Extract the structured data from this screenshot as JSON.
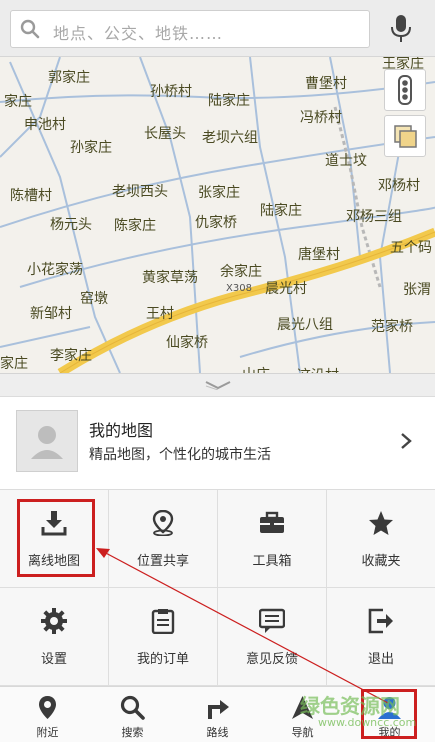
{
  "search": {
    "placeholder": "地点、公交、地铁……"
  },
  "map": {
    "places": [
      "王家庄",
      "郭家庄",
      "孙桥村",
      "曹堡村",
      "家庄",
      "陆家庄",
      "申池村",
      "冯桥村",
      "长屋头",
      "老坝六组",
      "孙家庄",
      "道士坟",
      "陈槽村",
      "老坝西头",
      "张家庄",
      "邓杨村",
      "杨元头",
      "陈家庄",
      "仇家桥",
      "陆家庄",
      "邓杨三组",
      "五个码",
      "唐堡村",
      "小花家荡",
      "黄家草荡",
      "余家庄",
      "窑墩",
      "晨光村",
      "张渭",
      "新邹村",
      "王村",
      "晨光八组",
      "范家桥",
      "仙家桥",
      "李家庄",
      "家庄",
      "山庄",
      "这沿村"
    ],
    "road_label": "X308"
  },
  "mymap": {
    "title": "我的地图",
    "subtitle": "精品地图，个性化的城市生活"
  },
  "grid": [
    {
      "label": "离线地图",
      "icon": "download-icon"
    },
    {
      "label": "位置共享",
      "icon": "location-share-icon"
    },
    {
      "label": "工具箱",
      "icon": "toolbox-icon"
    },
    {
      "label": "收藏夹",
      "icon": "star-icon"
    },
    {
      "label": "设置",
      "icon": "gear-icon"
    },
    {
      "label": "我的订单",
      "icon": "clipboard-icon"
    },
    {
      "label": "意见反馈",
      "icon": "feedback-icon"
    },
    {
      "label": "退出",
      "icon": "exit-icon"
    }
  ],
  "nav": [
    {
      "label": "附近",
      "icon": "pin-icon"
    },
    {
      "label": "搜索",
      "icon": "search-icon"
    },
    {
      "label": "路线",
      "icon": "route-icon"
    },
    {
      "label": "导航",
      "icon": "navigation-icon"
    },
    {
      "label": "我的",
      "icon": "user-icon"
    }
  ],
  "watermark": {
    "title": "绿色资源网",
    "url": "www.downcc.com"
  },
  "colors": {
    "highlight": "#cc1f1f",
    "road_main": "#f2c94c",
    "icon_dark": "#3a3a3a"
  }
}
